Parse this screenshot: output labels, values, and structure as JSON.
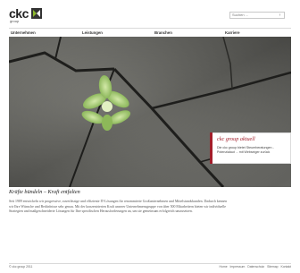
{
  "logo": {
    "name": "ckc",
    "sub": "group"
  },
  "search": {
    "placeholder": "Suchen ..."
  },
  "nav": {
    "items": [
      {
        "label": "Unternehmen"
      },
      {
        "label": "Leistungen"
      },
      {
        "label": "Branchen"
      },
      {
        "label": "Karriere"
      }
    ]
  },
  "news": {
    "title": "ckc group aktuell",
    "text": "Die ckc group bietet Steuerberatungen - Potenzialaut ... mit Webseiger zurück"
  },
  "main": {
    "headline": "Kräfte bündeln – Kraft entfalten",
    "body": "Seit 1989 entwickeln wir progressive, zuverlässige und effiziente IT-Lösungen für renommierte Großunternehmen und Mittelstandskunden. Dadurch kennen wir Ihre Wünsche und Bedürfnisse sehr genau. Mit der konzentrierten Kraft unserer Unternehmensgruppe von über 500 Mitarbeitern bieten wir individuelle Strategien und maßgeschneiderte Lösungen für Ihre spezifischen Herausforderungen an, um sie gemeinsam erfolgreich umzusetzen."
  },
  "footer": {
    "copyright": "© ckc group 2011",
    "links": [
      "Home",
      "Impressum",
      "Datenschutz",
      "Sitemap",
      "Kontakt"
    ]
  },
  "colors": {
    "accent": "#a31d2a",
    "logo_mark": "#8cb82b"
  }
}
